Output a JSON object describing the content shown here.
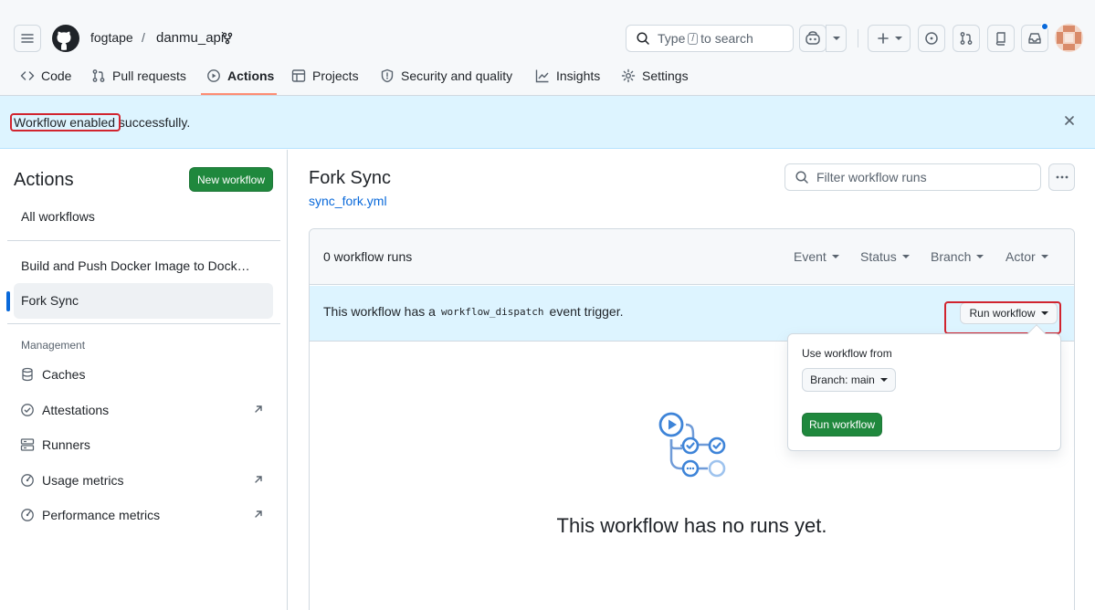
{
  "header": {
    "owner": "fogtape",
    "separator": "/",
    "repo": "danmu_api",
    "search": {
      "prefix": "Type",
      "key": "/",
      "suffix": "to search"
    }
  },
  "tabs": [
    {
      "label": "Code",
      "icon": "code-icon"
    },
    {
      "label": "Pull requests",
      "icon": "git-pull-request-icon"
    },
    {
      "label": "Actions",
      "icon": "play-icon",
      "active": true
    },
    {
      "label": "Projects",
      "icon": "table-icon"
    },
    {
      "label": "Security and quality",
      "icon": "shield-icon"
    },
    {
      "label": "Insights",
      "icon": "graph-icon"
    },
    {
      "label": "Settings",
      "icon": "gear-icon"
    }
  ],
  "flash": {
    "message": "Workflow enabled successfully."
  },
  "sidebar": {
    "title": "Actions",
    "new_workflow": "New workflow",
    "all_workflows": "All workflows",
    "workflows": [
      {
        "label": "Build and Push Docker Image to Dock…"
      },
      {
        "label": "Fork Sync",
        "active": true
      }
    ],
    "management_heading": "Management",
    "management": [
      {
        "label": "Caches",
        "icon": "database-icon"
      },
      {
        "label": "Attestations",
        "icon": "verified-icon"
      },
      {
        "label": "Runners",
        "icon": "server-icon"
      },
      {
        "label": "Usage metrics",
        "icon": "meter-icon"
      },
      {
        "label": "Performance metrics",
        "icon": "meter-icon"
      }
    ]
  },
  "main": {
    "title": "Fork Sync",
    "file": "sync_fork.yml",
    "filter_placeholder": "Filter workflow runs",
    "runs_count": "0 workflow runs",
    "filters": [
      "Event",
      "Status",
      "Branch",
      "Actor"
    ],
    "dispatch_prefix": "This workflow has a",
    "dispatch_code": "workflow_dispatch",
    "dispatch_suffix": "event trigger.",
    "run_workflow_label": "Run workflow",
    "empty_title": "This workflow has no runs yet."
  },
  "popover": {
    "use_from": "Use workflow from",
    "branch": "Branch: main",
    "submit": "Run workflow"
  },
  "colors": {
    "accent": "#0969da",
    "green": "#1f883d",
    "highlight": "#d1242f",
    "flash_bg": "#ddf4ff"
  }
}
